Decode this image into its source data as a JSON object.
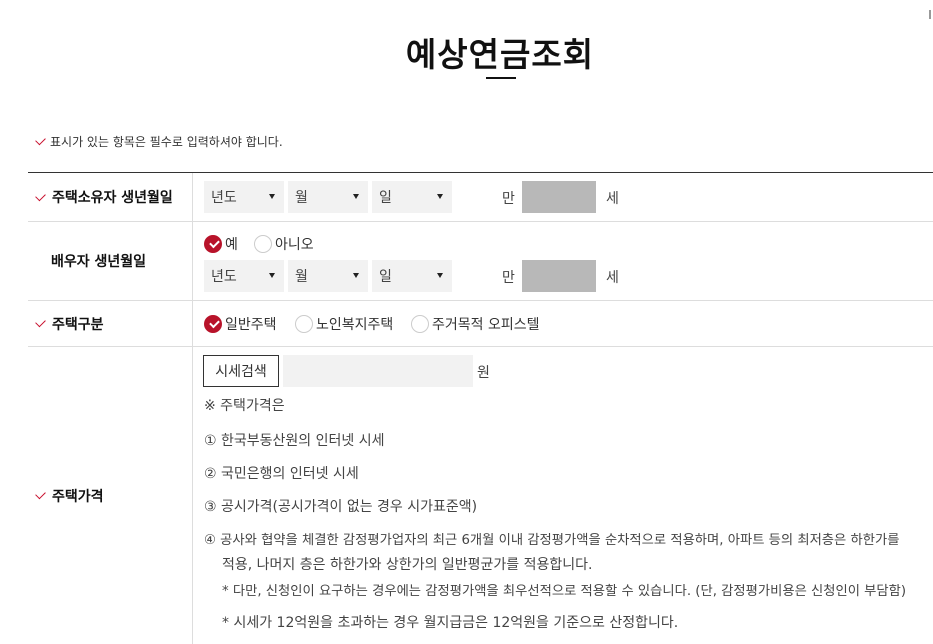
{
  "title": "예상연금조회",
  "required_note": "표시가 있는 항목은 필수로 입력하셔야 합니다.",
  "rows": {
    "owner_birth": {
      "label": "주택소유자 생년월일",
      "year_placeholder": "년도",
      "month_placeholder": "월",
      "day_placeholder": "일",
      "age_prefix": "만",
      "age_suffix": "세"
    },
    "spouse_birth": {
      "label": "배우자 생년월일",
      "yes_label": "예",
      "no_label": "아니오",
      "yes_selected": true,
      "year_placeholder": "년도",
      "month_placeholder": "월",
      "day_placeholder": "일",
      "age_prefix": "만",
      "age_suffix": "세"
    },
    "house_type": {
      "label": "주택구분",
      "options": [
        "일반주택",
        "노인복지주택",
        "주거목적 오피스텔"
      ],
      "selected_index": 0
    },
    "house_price": {
      "label": "주택가격",
      "search_button": "시세검색",
      "unit": "원",
      "notes_heading": "※ 주택가격은",
      "notes": [
        "① 한국부동산원의 인터넷 시세",
        "② 국민은행의 인터넷 시세",
        "③ 공시가격(공시가격이 없는 경우 시가표준액)",
        "④ 공사와 협약을 체결한 감정평가업자의 최근 6개월 이내 감정평가액을 순차적으로 적용하며, 아파트 등의 최저층은 하한가를",
        "적용, 나머지 층은 하한가와 상한가의 일반평균가를 적용합니다.",
        "* 다만, 신청인이 요구하는 경우에는 감정평가액을 최우선적으로 적용할 수 있습니다. (단, 감정평가비용은 신청인이 부담함)",
        "* 시세가 12억원을 초과하는 경우 월지급금은 12억원을 기준으로 산정합니다."
      ]
    }
  },
  "colors": {
    "accent": "#b8132a",
    "age_box": "#b8b8b8",
    "input_bg": "#f2f2f2"
  }
}
